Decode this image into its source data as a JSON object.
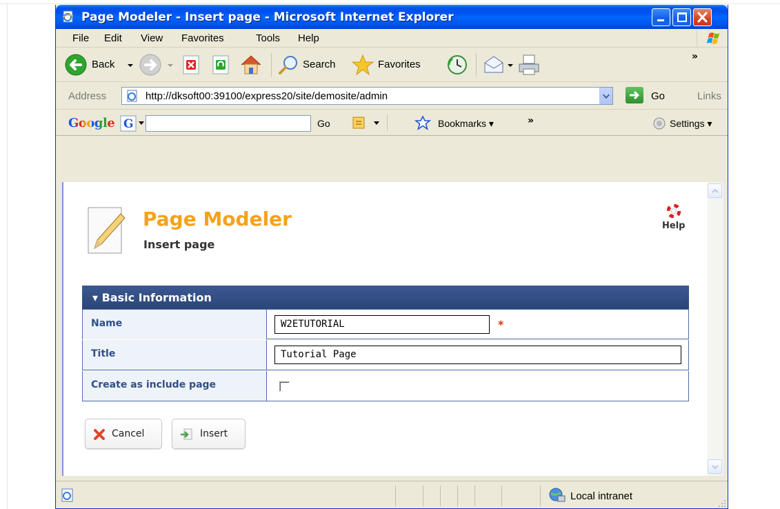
{
  "window": {
    "title": "Page Modeler - Insert page - Microsoft Internet Explorer"
  },
  "menu": {
    "items": [
      {
        "label": "File"
      },
      {
        "label": "Edit"
      },
      {
        "label": "View"
      },
      {
        "label": "Favorites"
      },
      {
        "label": "Tools"
      },
      {
        "label": "Help"
      }
    ]
  },
  "toolbar": {
    "back_label": "Back",
    "search_label": "Search",
    "favorites_label": "Favorites",
    "more": "»"
  },
  "address": {
    "label": "Address",
    "url": "http://dksoft00:39100/express20/site/demosite/admin",
    "go_label": "Go",
    "links_label": "Links"
  },
  "google_bar": {
    "logo": "Google",
    "search_value": "",
    "go_label": "Go",
    "bookmarks_label": "Bookmarks",
    "more": "»",
    "settings_label": "Settings"
  },
  "page": {
    "title": "Page Modeler",
    "subtitle": "Insert page",
    "help_label": "Help"
  },
  "panel": {
    "header": "Basic Information",
    "fields": {
      "name_label": "Name",
      "name_value": "W2ETUTORIAL",
      "title_label": "Title",
      "title_value": "Tutorial Page",
      "include_label": "Create as include page",
      "include_checked": false
    }
  },
  "buttons": {
    "cancel_label": "Cancel",
    "insert_label": "Insert"
  },
  "status": {
    "zone_label": "Local intranet"
  },
  "colors": {
    "title_bar": "#0054e3",
    "page_title": "#f7a11a",
    "panel_header": "#2f4b80",
    "label_text": "#2f4f86",
    "required": "#e03010"
  }
}
